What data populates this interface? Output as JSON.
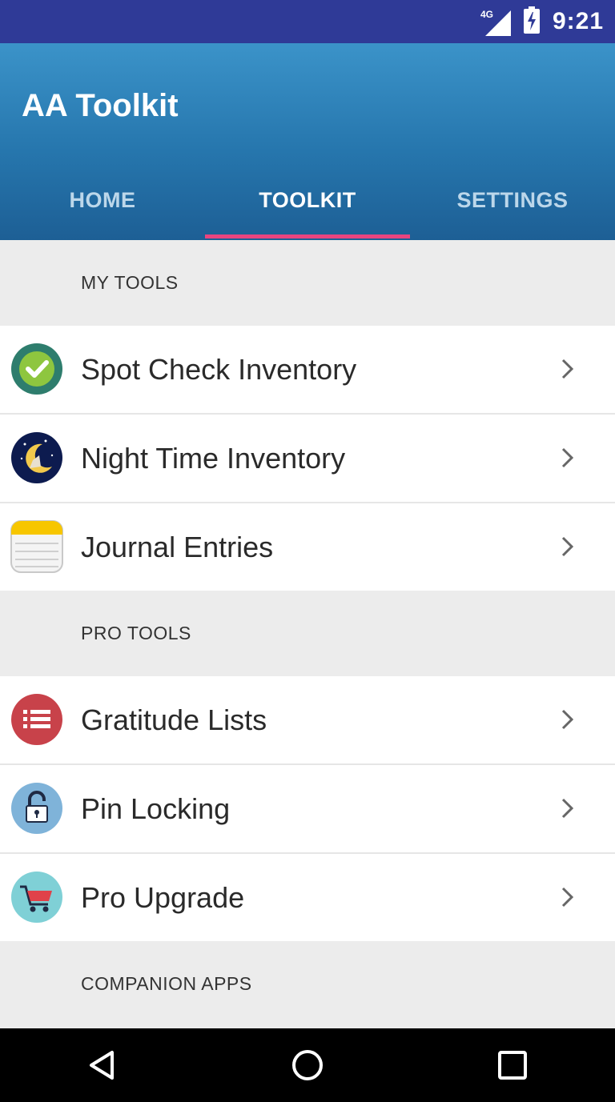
{
  "status_bar": {
    "network": "4G",
    "time": "9:21"
  },
  "app": {
    "title": "AA Toolkit"
  },
  "tabs": [
    {
      "label": "HOME",
      "active": false
    },
    {
      "label": "TOOLKIT",
      "active": true
    },
    {
      "label": "SETTINGS",
      "active": false
    }
  ],
  "sections": {
    "my_tools": {
      "header": "MY TOOLS",
      "items": [
        {
          "label": "Spot Check Inventory",
          "icon": "check-circle-icon"
        },
        {
          "label": "Night Time Inventory",
          "icon": "moon-night-icon"
        },
        {
          "label": "Journal Entries",
          "icon": "notepad-icon"
        }
      ]
    },
    "pro_tools": {
      "header": "PRO TOOLS",
      "items": [
        {
          "label": "Gratitude Lists",
          "icon": "list-icon"
        },
        {
          "label": "Pin Locking",
          "icon": "lock-icon"
        },
        {
          "label": "Pro Upgrade",
          "icon": "shopping-cart-icon"
        }
      ]
    },
    "companion_apps": {
      "header": "COMPANION APPS"
    }
  },
  "colors": {
    "status_bar": "#2f3a97",
    "app_bar": "#2676ad",
    "tab_indicator": "#e8457f"
  }
}
